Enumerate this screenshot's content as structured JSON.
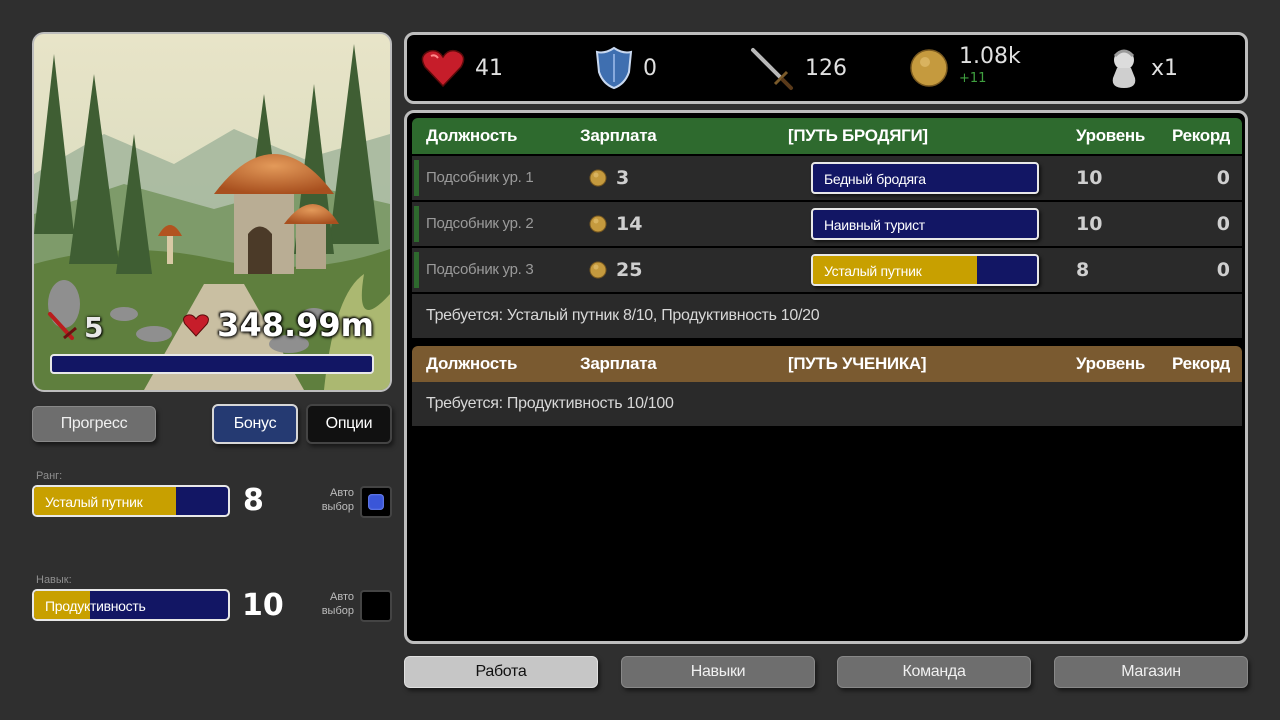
{
  "colors": {
    "accent_gold": "#c8a000",
    "bar_navy": "#121664",
    "path_vagrant_header": "#2e6a2e",
    "path_student_header": "#7a5a30",
    "bonus_button": "#253a72"
  },
  "resources": {
    "health": {
      "icon": "heart-icon",
      "value": "41"
    },
    "defense": {
      "icon": "shield-icon",
      "value": "0"
    },
    "attack": {
      "icon": "sword-icon",
      "value": "126"
    },
    "coins": {
      "icon": "coin-icon",
      "value": "1.08k",
      "delta": "+11"
    },
    "multiplier": {
      "icon": "bust-icon",
      "value": "x1"
    }
  },
  "character": {
    "attack_value": "5",
    "health_value": "348.99m"
  },
  "left_buttons": {
    "progress": "Прогресс",
    "bonus": "Бонус",
    "options": "Опции"
  },
  "rank": {
    "label": "Ранг:",
    "name": "Усталый путник",
    "value": "8",
    "progress": 0.73,
    "auto_label_1": "Авто",
    "auto_label_2": "выбор",
    "auto_enabled": true
  },
  "skill": {
    "label": "Навык:",
    "name": "Продуктивность",
    "value": "10",
    "progress": 0.29,
    "auto_label_1": "Авто",
    "auto_label_2": "выбор",
    "auto_enabled": false
  },
  "headers": {
    "position": "Должность",
    "salary": "Зарплата",
    "level": "Уровень",
    "record": "Рекорд"
  },
  "paths": [
    {
      "title": "[ПУТЬ БРОДЯГИ]",
      "jobs": [
        {
          "name": "Подсобник ур. 1",
          "salary": "3",
          "rank": "Бедный бродяга",
          "progress": 0,
          "level": "10",
          "record": "0"
        },
        {
          "name": "Подсобник ур. 2",
          "salary": "14",
          "rank": "Наивный турист",
          "progress": 0,
          "level": "10",
          "record": "0"
        },
        {
          "name": "Подсобник ур. 3",
          "salary": "25",
          "rank": "Усталый путник",
          "progress": 0.73,
          "level": "8",
          "record": "0"
        }
      ],
      "requirement": "Требуется:  Усталый путник 8/10,  Продуктивность 10/20"
    },
    {
      "title": "[ПУТЬ УЧЕНИКА]",
      "jobs": [],
      "requirement": "Требуется:  Продуктивность 10/100"
    }
  ],
  "tabs": {
    "work": "Работа",
    "skills": "Навыки",
    "team": "Команда",
    "shop": "Магазин"
  }
}
